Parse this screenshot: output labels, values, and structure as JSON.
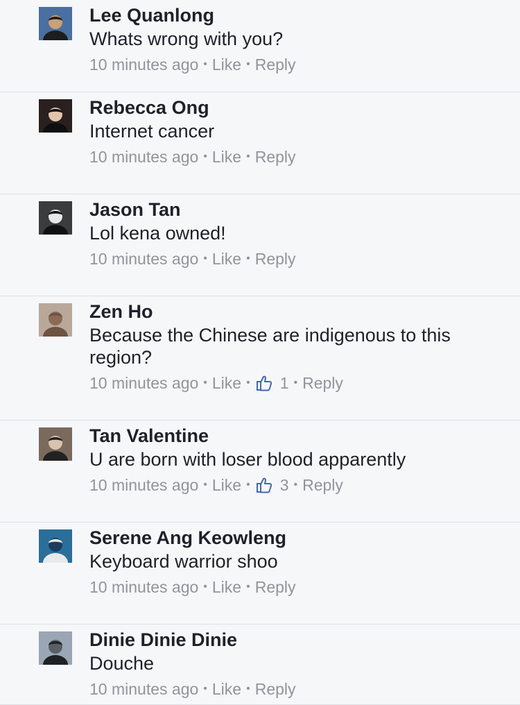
{
  "comments": [
    {
      "name": "Lee Quanlong",
      "text": "Whats wrong with you?",
      "time": "10 minutes ago",
      "like_label": "Like",
      "reply_label": "Reply",
      "likes": null,
      "avatar": {
        "icon": "avatar-lee-quanlong",
        "bg": "#4a6fa0",
        "fg": "#1d1d1d",
        "skin": "#c9a07a"
      }
    },
    {
      "name": "Rebecca Ong",
      "text": "Internet cancer",
      "time": "10 minutes ago",
      "like_label": "Like",
      "reply_label": "Reply",
      "likes": null,
      "avatar": {
        "icon": "avatar-rebecca-ong",
        "bg": "#2a2020",
        "fg": "#0f0f0f",
        "skin": "#e3c4ad"
      }
    },
    {
      "name": "Jason Tan",
      "text": "Lol kena owned!",
      "time": "10 minutes ago",
      "like_label": "Like",
      "reply_label": "Reply",
      "likes": null,
      "avatar": {
        "icon": "avatar-jason-tan",
        "bg": "#3a3c3e",
        "fg": "#111",
        "skin": "#e8e8e8"
      }
    },
    {
      "name": "Zen Ho",
      "text": "Because the Chinese are indigenous to this region?",
      "time": "10 minutes ago",
      "like_label": "Like",
      "reply_label": "Reply",
      "likes": "1",
      "avatar": {
        "icon": "avatar-zen-ho",
        "bg": "#b9a89a",
        "fg": "#6e5242",
        "skin": "#8a6a55"
      }
    },
    {
      "name": "Tan Valentine",
      "text": "U are born with loser blood apparently",
      "time": "10 minutes ago",
      "like_label": "Like",
      "reply_label": "Reply",
      "likes": "3",
      "avatar": {
        "icon": "avatar-tan-valentine",
        "bg": "#7a6a5e",
        "fg": "#222",
        "skin": "#d8c3b0"
      }
    },
    {
      "name": "Serene Ang Keowleng",
      "text": "Keyboard warrior shoo",
      "time": "10 minutes ago",
      "like_label": "Like",
      "reply_label": "Reply",
      "likes": null,
      "avatar": {
        "icon": "avatar-serene-ang-keowleng",
        "bg": "#2a6f9a",
        "fg": "#e9e9e9",
        "skin": "#1b3d5c"
      }
    },
    {
      "name": "Dinie Dinie Dinie",
      "text": "Douche",
      "time": "10 minutes ago",
      "like_label": "Like",
      "reply_label": "Reply",
      "likes": null,
      "avatar": {
        "icon": "avatar-dinie-dinie-dinie",
        "bg": "#9aa6b4",
        "fg": "#1e2126",
        "skin": "#5a5f66"
      }
    }
  ],
  "colors": {
    "background": "#f6f7f9",
    "name_text": "#1d2129",
    "meta_text": "#90949c",
    "divider": "#dddfe2",
    "like_icon": "#4267b2"
  }
}
